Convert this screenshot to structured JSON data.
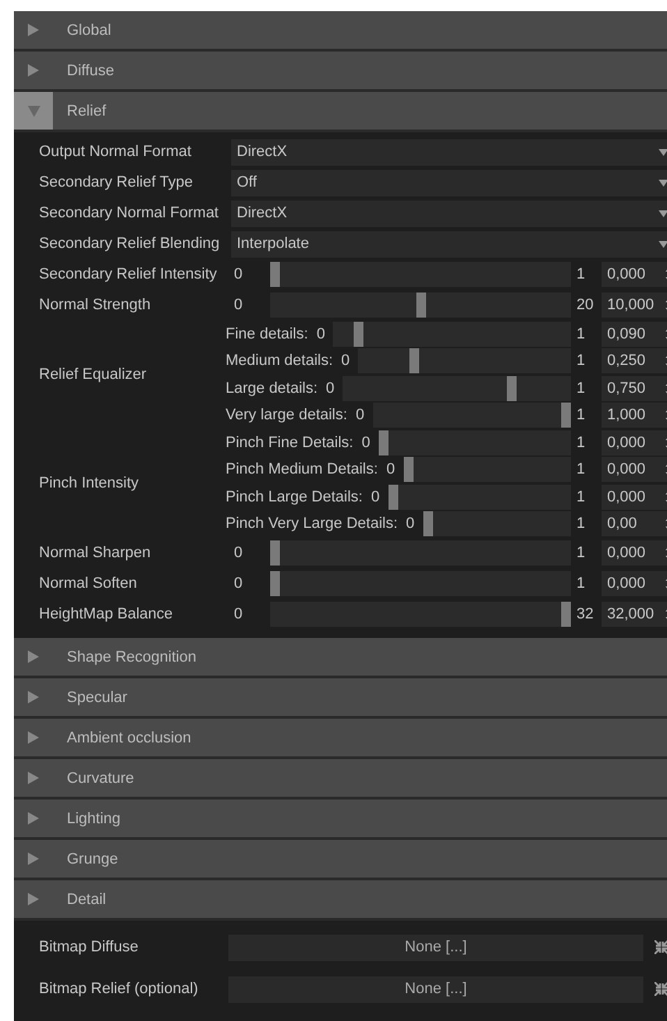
{
  "sections": [
    {
      "title": "Global",
      "expanded": false
    },
    {
      "title": "Diffuse",
      "expanded": false
    },
    {
      "title": "Relief",
      "expanded": true,
      "rows": [
        {
          "kind": "dropdown",
          "label": "Output Normal Format",
          "value": "DirectX"
        },
        {
          "kind": "dropdown",
          "label": "Secondary Relief Type",
          "value": "Off"
        },
        {
          "kind": "dropdown",
          "label": "Secondary Normal Format",
          "value": "DirectX"
        },
        {
          "kind": "dropdown",
          "label": "Secondary Relief Blending",
          "value": "Interpolate"
        },
        {
          "kind": "slider",
          "label": "Secondary Relief Intensity",
          "min": "0",
          "max": "1",
          "value": "0,000",
          "level": 0
        },
        {
          "kind": "slider",
          "label": "Normal Strength",
          "min": "0",
          "max": "20",
          "value": "10,000",
          "level": 0.5
        },
        {
          "kind": "group",
          "label": "Relief Equalizer",
          "children": [
            {
              "label": "Fine details:",
              "min": "0",
              "max": "1",
              "value": "0,090",
              "level": 0.09
            },
            {
              "label": "Medium details:",
              "min": "0",
              "max": "1",
              "value": "0,250",
              "level": 0.25
            },
            {
              "label": "Large details:",
              "min": "0",
              "max": "1",
              "value": "0,750",
              "level": 0.75
            },
            {
              "label": "Very large details:",
              "min": "0",
              "max": "1",
              "value": "1,000",
              "level": 1
            }
          ]
        },
        {
          "kind": "group",
          "label": "Pinch Intensity",
          "children": [
            {
              "label": "Pinch Fine Details:",
              "min": "0",
              "max": "1",
              "value": "0,000",
              "level": 0
            },
            {
              "label": "Pinch Medium Details:",
              "min": "0",
              "max": "1",
              "value": "0,000",
              "level": 0
            },
            {
              "label": "Pinch Large Details:",
              "min": "0",
              "max": "1",
              "value": "0,000",
              "level": 0
            },
            {
              "label": "Pinch Very Large Details:",
              "min": "0",
              "max": "1",
              "value": "0,00",
              "level": 0
            }
          ]
        },
        {
          "kind": "slider",
          "label": "Normal Sharpen",
          "min": "0",
          "max": "1",
          "value": "0,000",
          "level": 0
        },
        {
          "kind": "slider",
          "label": "Normal Soften",
          "min": "0",
          "max": "1",
          "value": "0,000",
          "level": 0
        },
        {
          "kind": "slider",
          "label": "HeightMap Balance",
          "min": "0",
          "max": "32",
          "value": "32,000",
          "level": 1
        }
      ]
    },
    {
      "title": "Shape Recognition",
      "expanded": false
    },
    {
      "title": "Specular",
      "expanded": false
    },
    {
      "title": "Ambient occlusion",
      "expanded": false
    },
    {
      "title": "Curvature",
      "expanded": false
    },
    {
      "title": "Lighting",
      "expanded": false
    },
    {
      "title": "Grunge",
      "expanded": false
    },
    {
      "title": "Detail",
      "expanded": false
    }
  ],
  "bitmaps": [
    {
      "label": "Bitmap Diffuse",
      "value": "None [...]"
    },
    {
      "label": "Bitmap Relief (optional)",
      "value": "None [...]"
    }
  ]
}
